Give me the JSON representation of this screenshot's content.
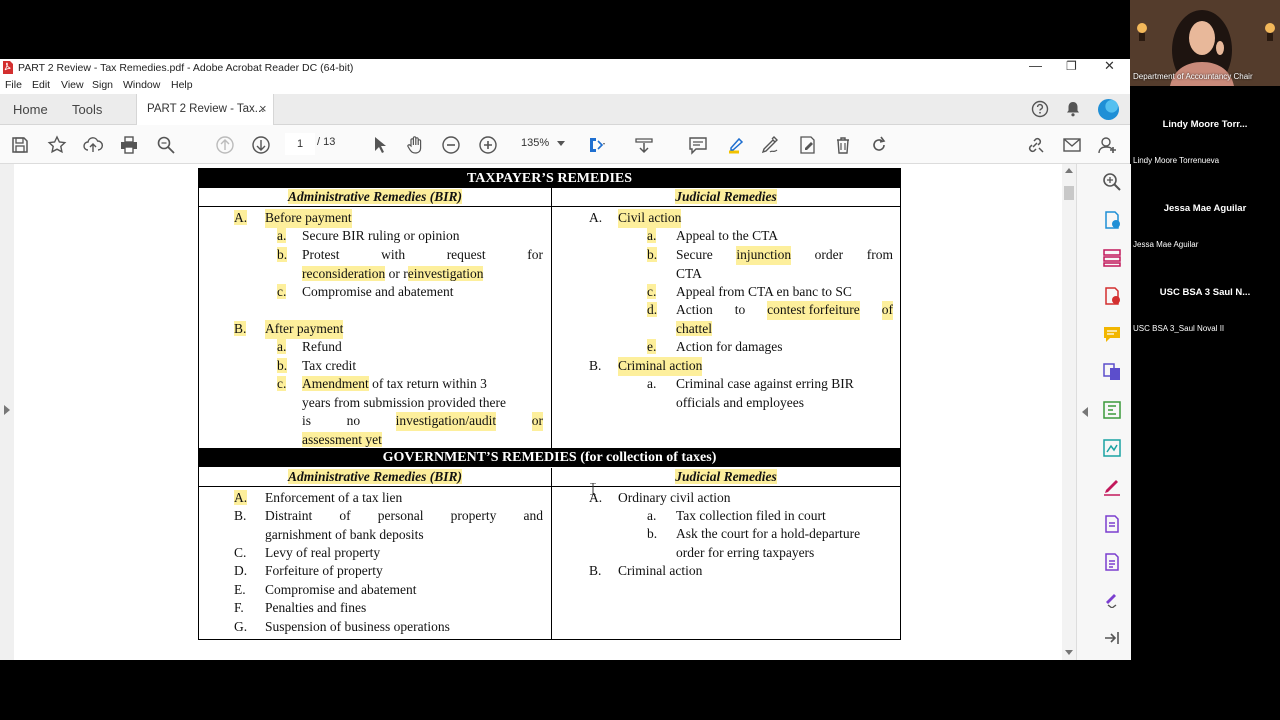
{
  "window": {
    "title": "PART 2 Review - Tax Remedies.pdf - Adobe Acrobat Reader DC (64-bit)",
    "controls": {
      "minimize": "—",
      "restore": "❐",
      "close": "✕"
    }
  },
  "menu": {
    "items": [
      "File",
      "Edit",
      "View",
      "Sign",
      "Window",
      "Help"
    ]
  },
  "tabs": {
    "home": "Home",
    "tools": "Tools",
    "document": "PART 2 Review - Tax...",
    "close": "×"
  },
  "toolbar": {
    "page_current": "1",
    "page_sep": "/ 13",
    "zoom": "135%"
  },
  "document": {
    "header1": "TAXPAYER’S REMEDIES",
    "admin_header": "Administrative Remedies (BIR)",
    "judicial_header": "Judicial Remedies",
    "t_admin": {
      "A_marker": "A.",
      "A_label": "Before payment",
      "A_items": [
        {
          "m": "a.",
          "t": "Secure BIR ruling or opinion"
        },
        {
          "m": "b.",
          "t1": [
            "Protest",
            "with",
            "request",
            "for"
          ],
          "t2a": "reconsideration",
          "t2b": " or r",
          "t2c": "einvestigation"
        },
        {
          "m": "c.",
          "t": "Compromise and abatement"
        }
      ],
      "B_marker": "B.",
      "B_label": "After payment",
      "B_items": [
        {
          "m": "a.",
          "t": "Refund"
        },
        {
          "m": "b.",
          "t": "Tax credit"
        },
        {
          "m": "c.",
          "t1a": "Amendment",
          "t1b": " of tax return within 3",
          "t2": "years from submission provided there",
          "t3": [
            "is",
            "no",
            "investigation/audit",
            "or"
          ],
          "t4": "assessment yet"
        }
      ]
    },
    "t_judicial": {
      "A_marker": "A.",
      "A_label": "Civil action",
      "A_items": [
        {
          "m": "a.",
          "t": "Appeal to the CTA"
        },
        {
          "m": "b.",
          "t1": [
            "Secure",
            "injunction",
            "order",
            "from"
          ],
          "t2": "CTA"
        },
        {
          "m": "c.",
          "t": "Appeal from CTA en banc to SC"
        },
        {
          "m": "d.",
          "t1": [
            "Action",
            "to",
            "contest forfeiture",
            "of"
          ],
          "t2": "chattel"
        },
        {
          "m": "e.",
          "t": "Action for damages"
        }
      ],
      "B_marker": "B.",
      "B_label": "Criminal action",
      "B_items": [
        {
          "m": "a.",
          "t1": "Criminal case against erring BIR",
          "t2": "officials and employees"
        }
      ]
    },
    "header2": "GOVERNMENT’S REMEDIES (for collection of taxes)",
    "g_admin": [
      {
        "m": "A.",
        "t": "Enforcement of a tax lien"
      },
      {
        "m": "B.",
        "t1": [
          "Distraint",
          "of",
          "personal",
          "property",
          "and"
        ],
        "t2": "garnishment of bank deposits"
      },
      {
        "m": "C.",
        "t": "Levy of real property"
      },
      {
        "m": "D.",
        "t": "Forfeiture of property"
      },
      {
        "m": "E.",
        "t": "Compromise and abatement"
      },
      {
        "m": "F.",
        "t": "Penalties and fines"
      },
      {
        "m": "G.",
        "t": "Suspension of business operations"
      }
    ],
    "g_judicial": {
      "A_marker": "A.",
      "A_label": "Ordinary civil action",
      "A_items": [
        {
          "m": "a.",
          "t": "Tax collection filed in court"
        },
        {
          "m": "b.",
          "t1": "Ask the court for a hold-departure",
          "t2": "order for erring taxpayers"
        }
      ],
      "B_marker": "B.",
      "B_label": "Criminal action"
    }
  },
  "meeting": {
    "host_caption": "Department of Accountancy Chair",
    "participants": [
      {
        "name": "Lindy Moore Torr...",
        "sub": "Lindy Moore Torrenueva"
      },
      {
        "name": "Jessa Mae Aguilar",
        "sub": "Jessa Mae Aguilar"
      },
      {
        "name": "USC BSA 3  Saul N...",
        "sub": "USC BSA 3_Saul Noval II"
      }
    ]
  },
  "colors": {
    "highlight": "#fdef9c",
    "accent": "#1f8fd6"
  }
}
